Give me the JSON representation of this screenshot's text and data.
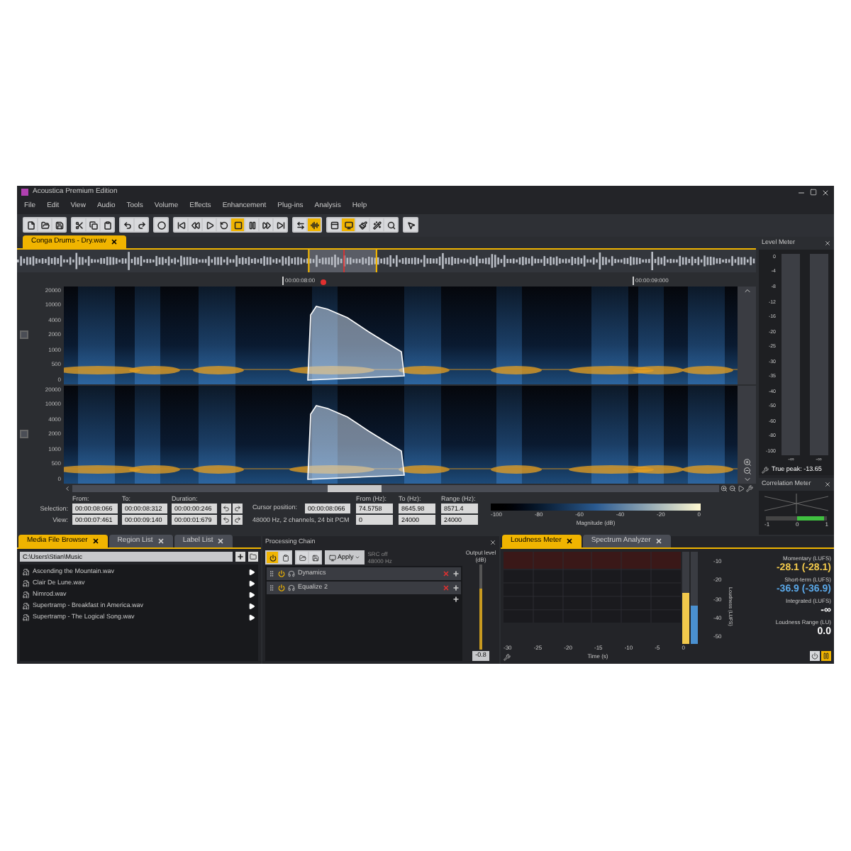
{
  "window": {
    "title": "Acoustica Premium Edition"
  },
  "menu": [
    "File",
    "Edit",
    "View",
    "Audio",
    "Tools",
    "Volume",
    "Effects",
    "Enhancement",
    "Plug-ins",
    "Analysis",
    "Help"
  ],
  "toolbar": [
    {
      "on": false
    },
    {
      "on": false
    },
    {
      "on": false
    },
    {
      "on": false
    },
    {
      "on": false
    },
    {
      "on": false
    },
    {
      "on": false
    },
    {
      "on": false
    },
    {
      "on": false
    },
    {
      "on": false
    },
    {
      "on": false
    },
    {
      "on": false
    },
    {
      "on": false
    },
    {
      "on": true
    },
    {
      "on": false
    },
    {
      "on": false
    },
    {
      "on": false
    },
    {
      "on": false
    },
    {
      "on": true
    },
    {
      "on": false
    },
    {
      "on": true
    },
    {
      "on": false
    },
    {
      "on": false
    },
    {
      "on": false
    },
    {
      "on": false
    }
  ],
  "document_tabs": [
    {
      "label": "Conga Drums - Dry.wav",
      "selected": true
    }
  ],
  "timeline": {
    "markers": [
      "00:00:08:00",
      "00:00:09:000"
    ]
  },
  "frequency_axis": [
    [
      "20000",
      "10000",
      "4000",
      "2000",
      "1000",
      "500",
      "0"
    ],
    [
      "20000",
      "10000",
      "4000",
      "2000",
      "1000",
      "500",
      "0"
    ]
  ],
  "selection_info": {
    "col_headers": [
      "From:",
      "To:",
      "Duration:"
    ],
    "rows": [
      {
        "label": "Selection:",
        "values": [
          "00:00:08:066",
          "00:00:08:312",
          "00:00:00:246"
        ]
      },
      {
        "label": "View:",
        "values": [
          "00:00:07:461",
          "00:00:09:140",
          "00:00:01:679"
        ]
      }
    ],
    "cursor_label": "Cursor position:",
    "cursor_value": "00:00:08:066",
    "format": "48000 Hz, 2 channels, 24 bit PCM",
    "hz_headers": [
      "From (Hz):",
      "To (Hz):",
      "Range (Hz):"
    ],
    "hz_rows": [
      [
        "74.5758",
        "8645.98",
        "8571.4"
      ],
      [
        "0",
        "24000",
        "24000"
      ]
    ],
    "colorbar_ticks": [
      "-100",
      "-80",
      "-60",
      "-40",
      "-20",
      "0"
    ],
    "colorbar_label": "Magnitude (dB)"
  },
  "level_meter": {
    "title": "Level Meter",
    "scale": [
      "0",
      "-4",
      "-8",
      "-12",
      "-16",
      "-20",
      "-25",
      "-30",
      "-35",
      "-40",
      "-50",
      "-60",
      "-80",
      "-100"
    ],
    "readings": [
      "-∞",
      "-∞"
    ],
    "true_peak": "True peak: -13.65"
  },
  "correlation_meter": {
    "title": "Correlation Meter",
    "ticks": [
      "-1",
      "0",
      "1"
    ]
  },
  "file_panel": {
    "tabs": [
      {
        "label": "Media File Browser",
        "selected": true
      },
      {
        "label": "Region List",
        "selected": false
      },
      {
        "label": "Label List",
        "selected": false
      }
    ],
    "path": "C:\\Users\\Stian\\Music",
    "files": [
      "Ascending the Mountain.wav",
      "Clair De Lune.wav",
      "Nimrod.wav",
      "Supertramp - Breakfast in America.wav",
      "Supertramp - The Logical Song.wav"
    ]
  },
  "processing_chain": {
    "title": "Processing Chain",
    "apply": "Apply",
    "src": "SRC off",
    "rate": "48000 Hz",
    "output_label": "Output level (dB)",
    "output_value": "-0.8",
    "output_slider": {
      "level": 0.72
    },
    "items": [
      {
        "name": "Dynamics",
        "enabled": true
      },
      {
        "name": "Equalize 2",
        "enabled": true
      }
    ]
  },
  "analysis_panel": {
    "tabs": [
      {
        "label": "Loudness Meter",
        "selected": true
      },
      {
        "label": "Spectrum Analyzer",
        "selected": false
      }
    ],
    "xticks": [
      "-30",
      "-25",
      "-20",
      "-15",
      "-10",
      "-5",
      "0"
    ],
    "xlabel": "Time (s)",
    "yticks": [
      "-10",
      "-20",
      "-30",
      "-40",
      "-50"
    ],
    "ylabel": "Loudness (LUFS)",
    "bars": [
      {
        "level": 0.55,
        "color": "#f2c94c"
      },
      {
        "level": 0.42,
        "color": "#4a90d0"
      }
    ],
    "readings": [
      {
        "label": "Momentary (LUFS)",
        "value": "-28.1 (-28.1)",
        "color": "#f2c94c"
      },
      {
        "label": "Short-term (LUFS)",
        "value": "-36.9 (-36.9)",
        "color": "#5aa8e8"
      },
      {
        "label": "Integrated (LUFS)",
        "value": "-∞",
        "color": "#ffffff"
      },
      {
        "label": "Loudness Range (LU)",
        "value": "0.0",
        "color": "#ffffff"
      }
    ],
    "paused": true
  }
}
